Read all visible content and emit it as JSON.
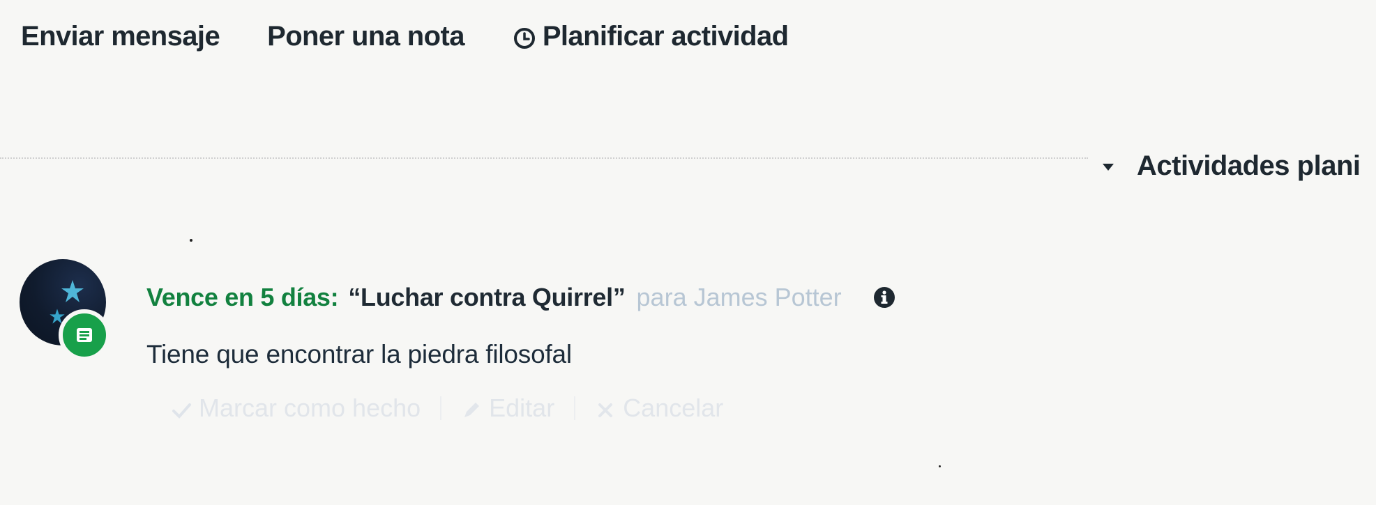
{
  "toolbar": {
    "send_message": "Enviar mensaje",
    "log_note": "Poner una nota",
    "schedule_activity": "Planificar actividad"
  },
  "section": {
    "title": "Actividades plani"
  },
  "activity": {
    "due_label": "Vence en 5 días:",
    "title": "“Luchar contra Quirrel”",
    "assignee": "para James Potter",
    "note": "Tiene que encontrar la piedra filosofal",
    "actions": {
      "mark_done": "Marcar como hecho",
      "edit": "Editar",
      "cancel": "Cancelar"
    }
  },
  "colors": {
    "due_green": "#12813f",
    "badge_green": "#18a04a",
    "muted_blue": "#b7c6d4"
  },
  "icons": {
    "schedule": "clock-icon",
    "section_toggle": "caret-down-icon",
    "info": "info-icon",
    "badge": "activity-type-icon",
    "mark_done": "check-icon",
    "edit": "pencil-icon",
    "cancel": "close-icon"
  }
}
